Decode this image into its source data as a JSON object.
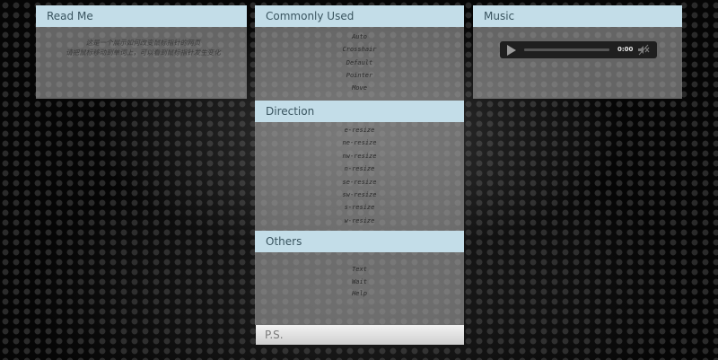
{
  "panels": {
    "readme": {
      "title": "Read Me",
      "lines": [
        "这是一个展示如何改变鼠标指针的网页",
        "请把鼠标移动到单词上，可以看到鼠标指针发生变化"
      ]
    },
    "commonly_used": {
      "title": "Commonly Used",
      "items": [
        "Auto",
        "Crosshair",
        "Default",
        "Pointer",
        "Move"
      ]
    },
    "music": {
      "title": "Music",
      "player": {
        "time": "0:00"
      }
    },
    "direction": {
      "title": "Direction",
      "items": [
        "e-resize",
        "ne-resize",
        "nw-resize",
        "n-resize",
        "se-resize",
        "sw-resize",
        "s-resize",
        "w-resize"
      ]
    },
    "others": {
      "title": "Others",
      "items": [
        "Text",
        "Wait",
        "Help"
      ]
    },
    "ps": {
      "title": "P.S."
    }
  },
  "colors": {
    "header_bg": "#c3dde8",
    "header_text": "#3a5560",
    "panel_bg": "#a5a5a5"
  }
}
